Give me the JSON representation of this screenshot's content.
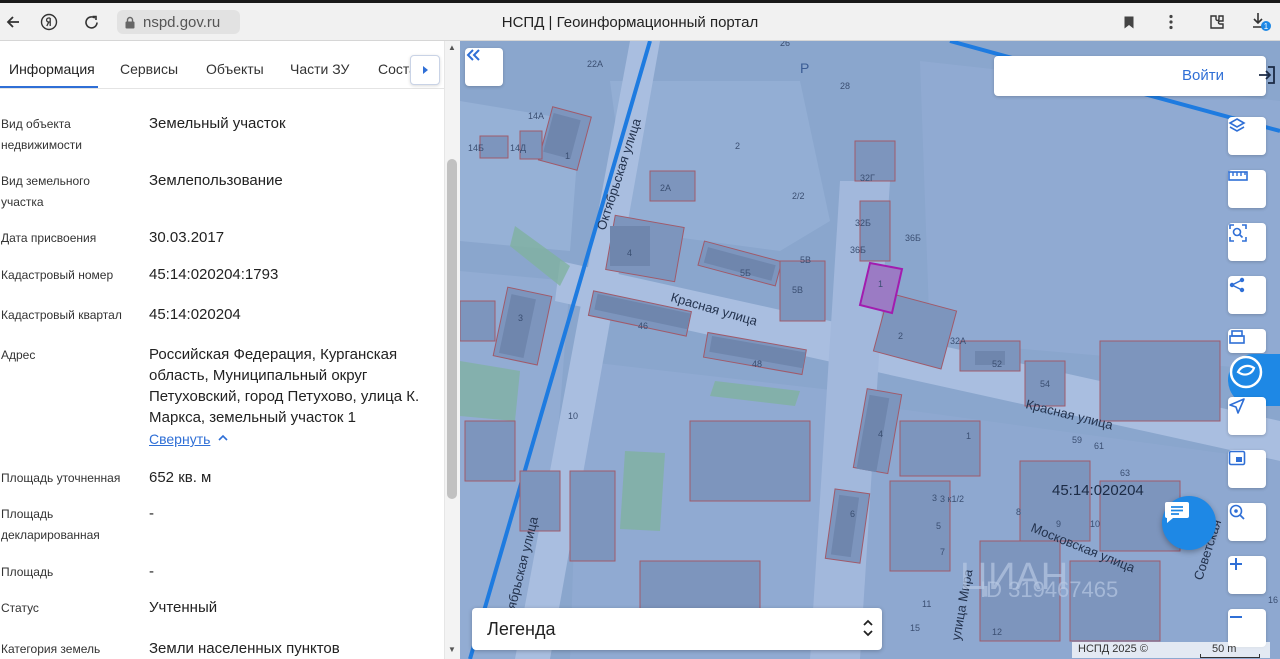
{
  "browser": {
    "url": "nspd.gov.ru",
    "title": "НСПД | Геоинформационный портал",
    "download_badge": "1"
  },
  "tabs": [
    {
      "label": "Информация",
      "active": true
    },
    {
      "label": "Сервисы",
      "active": false
    },
    {
      "label": "Объекты",
      "active": false
    },
    {
      "label": "Части ЗУ",
      "active": false
    },
    {
      "label": "Соста",
      "active": false
    }
  ],
  "info": [
    {
      "label": "Вид объекта недвижимости",
      "value": "Земельный участок"
    },
    {
      "label": "Вид земельного участка",
      "value": "Землепользование"
    },
    {
      "label": "Дата присвоения",
      "value": "30.03.2017"
    },
    {
      "label": "Кадастровый номер",
      "value": "45:14:020204:1793"
    },
    {
      "label": "Кадастровый квартал",
      "value": "45:14:020204"
    },
    {
      "label": "Адрес",
      "value": "Российская Федерация, Курганская область, Муниципальный округ Петуховский, город Петухово, улица К. Маркса, земельный участок 1"
    },
    {
      "label": "Площадь уточненная",
      "value": "652 кв. м"
    },
    {
      "label": "Площадь декларированная",
      "value": "-"
    },
    {
      "label": "Площадь",
      "value": "-"
    },
    {
      "label": "Статус",
      "value": "Учтенный"
    },
    {
      "label": "Категория земель",
      "value": "Земли населенных пунктов"
    }
  ],
  "collapse_link": "Свернуть",
  "map": {
    "login_label": "Войти",
    "legend_label": "Легенда",
    "cadastral_quarter": "45:14:020204",
    "copyright": "НСПД 2025 ©",
    "scale": "50 m",
    "streets": {
      "krasnaya_1": "Красная улица",
      "krasnaya_2": "Красная улица",
      "oktyabrskaya_1": "Октябрьская улица",
      "oktyabrskaya_2": "Октябрьская улица",
      "moskovskaya": "Московская улица",
      "mira": "улица Мира",
      "sovetskaya": "Советская"
    },
    "parcel_numbers": [
      "22А",
      "26",
      "28",
      "Р",
      "14А",
      "14Б",
      "14Д",
      "1",
      "2",
      "2А",
      "2/2",
      "32Г",
      "32Б",
      "36Б",
      "4",
      "5Б",
      "5В",
      "5В",
      "1",
      "46",
      "48",
      "3",
      "52",
      "54",
      "10",
      "59",
      "61",
      "4",
      "1",
      "63",
      "6",
      "3",
      "5",
      "7",
      "8",
      "9",
      "10",
      "11",
      "12",
      "15",
      "16",
      "32",
      "32А",
      "4",
      "2"
    ],
    "selected_parcel": "1",
    "watermark": "ЦИАН",
    "watermark_phone": "ID 319467465",
    "accent_color": "#1e88e5",
    "selection_color": "#a21caf"
  }
}
